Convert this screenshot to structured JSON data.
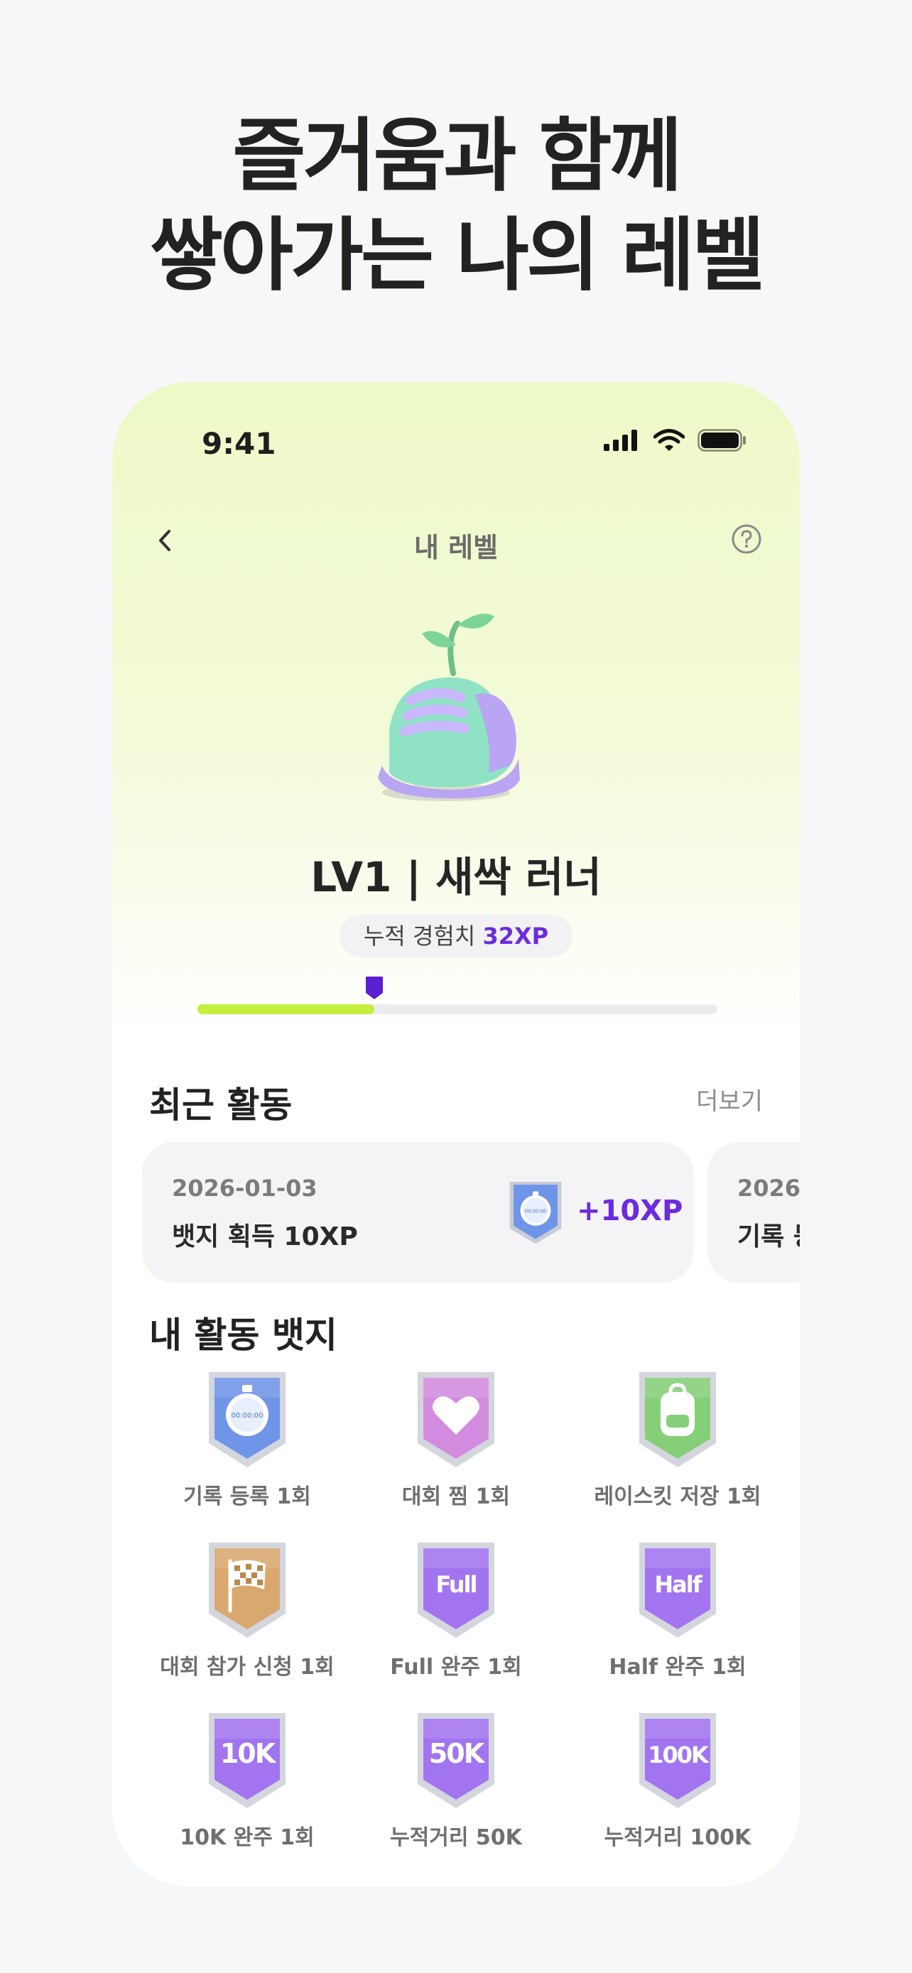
{
  "headline": {
    "line1": "즐거움과 함께",
    "line2": "쌓아가는 나의 레벨"
  },
  "status_bar": {
    "time": "9:41"
  },
  "navbar": {
    "title": "내 레벨",
    "back_icon": "chevron-left-icon",
    "help_icon": "question-circle-icon"
  },
  "level": {
    "title": "LV1 | 새싹 러너",
    "xp_label": "누적 경험치",
    "xp_value": "32XP",
    "progress_fraction": 0.34
  },
  "recent_activity": {
    "title": "최근 활동",
    "more_label": "더보기",
    "cards": [
      {
        "date": "2026-01-03",
        "description": "뱃지 획득 10XP",
        "xp": "+10XP",
        "badge_icon": "stopwatch-badge-icon"
      },
      {
        "date": "2026-",
        "description": "기록 등"
      }
    ]
  },
  "badges": {
    "title": "내 활동 뱃지",
    "items": [
      {
        "label": "기록 등록 1회",
        "icon": "stopwatch",
        "color": "#6f95e8",
        "color_dark": "#4e74cc",
        "text": "00:00:00"
      },
      {
        "label": "대회 찜 1회",
        "icon": "heart",
        "color": "#d38be0",
        "color_dark": "#b566c9",
        "text": ""
      },
      {
        "label": "레이스킷 저장 1회",
        "icon": "backpack",
        "color": "#86cf79",
        "color_dark": "#5fae53",
        "text": ""
      },
      {
        "label": "대회 참가 신청 1회",
        "icon": "flag",
        "color": "#d9a86e",
        "color_dark": "#bb884c",
        "text": ""
      },
      {
        "label": "Full 완주 1회",
        "icon": "text",
        "color": "#a274f0",
        "color_dark": "#7d4ad8",
        "text": "Full"
      },
      {
        "label": "Half 완주 1회",
        "icon": "text",
        "color": "#a274f0",
        "color_dark": "#7d4ad8",
        "text": "Half"
      },
      {
        "label": "10K 완주 1회",
        "icon": "text",
        "color": "#a274f0",
        "color_dark": "#7d4ad8",
        "text": "10K"
      },
      {
        "label": "누적거리 50K",
        "icon": "text",
        "color": "#a274f0",
        "color_dark": "#7d4ad8",
        "text": "50K"
      },
      {
        "label": "누적거리 100K",
        "icon": "text",
        "color": "#a274f0",
        "color_dark": "#7d4ad8",
        "text": "100K"
      }
    ]
  },
  "colors": {
    "accent_purple": "#6d2be0",
    "progress_green": "#c3f03c"
  }
}
